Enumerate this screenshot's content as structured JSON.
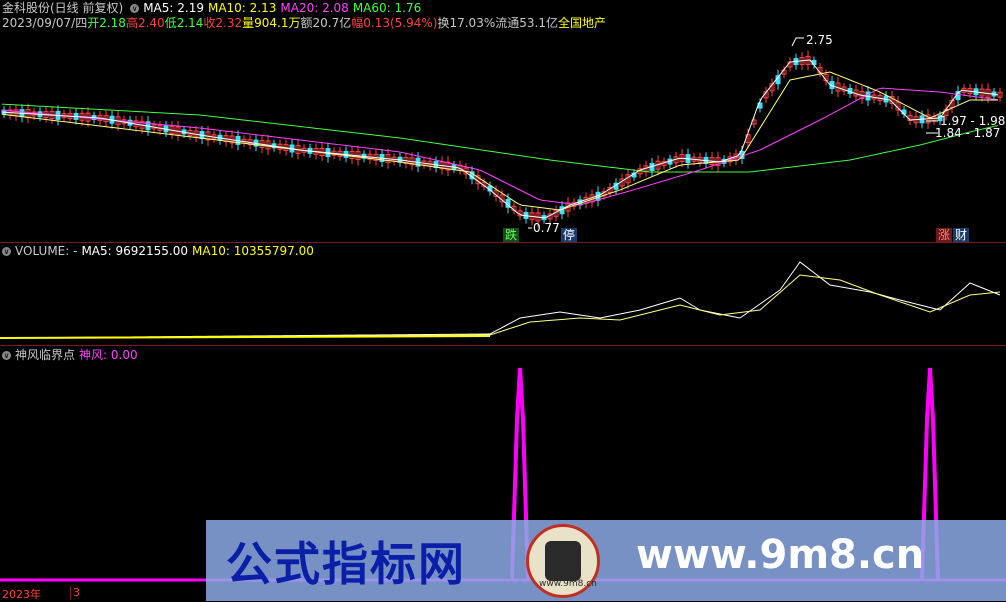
{
  "header": {
    "stock": "金科股份(日线 前复权)",
    "ma5": "MA5: 2.19",
    "ma10": "MA10: 2.13",
    "ma20": "MA20: 2.08",
    "ma60": "MA60: 1.76",
    "date": "2023/09/07/四",
    "open": "开2.18",
    "high": "高2.40",
    "low": "低2.14",
    "close": "收2.32",
    "volume": "量904.1万",
    "amount": "额20.7亿",
    "change": "幅0.13(5.94%)",
    "turnover": "换17.03%",
    "float": "流通53.1亿",
    "sector": "全国地产"
  },
  "price_labels": {
    "high_mark": "2.75",
    "low_mark": "0.77",
    "range1": "1.97 - 1.98",
    "range2": "1.84 - 1.87"
  },
  "events": {
    "tag_die": "跌",
    "tag_ting": "停",
    "tag_zhang": "涨",
    "tag_cai": "财"
  },
  "volume_panel": {
    "label": "VOLUME: -",
    "ma5": "MA5: 9692155.00",
    "ma10": "MA10: 10355797.00"
  },
  "indicator_panel": {
    "name": "神风临界点",
    "value_label": "神风: 0.00"
  },
  "axis": {
    "year": "2023年",
    "month": "3"
  },
  "watermark": {
    "left": "公式指标网",
    "right": "www.9m8.cn",
    "logo_sub": "www.9m8.cn"
  },
  "colors": {
    "ma5": "#ffffff",
    "ma10": "#ffff00",
    "ma20": "#ff40ff",
    "ma60": "#40ff40",
    "up": "#ff4040",
    "down": "#40e0ff",
    "indicator": "#ff00ff"
  }
}
